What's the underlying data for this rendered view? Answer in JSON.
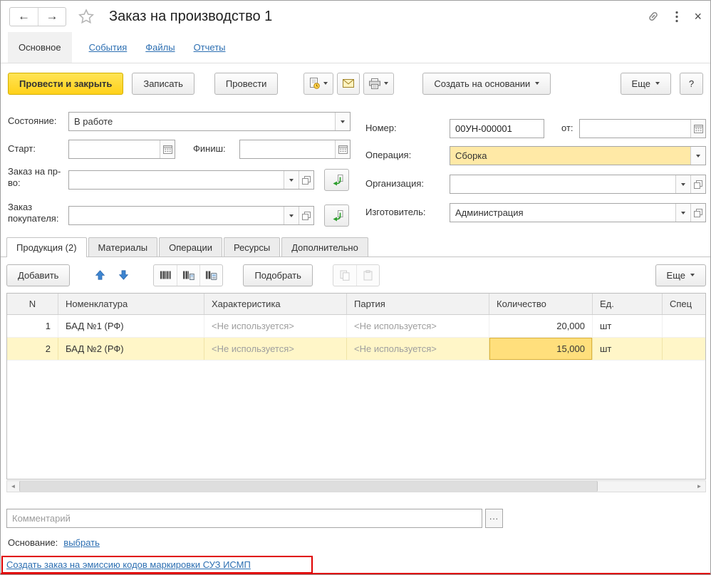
{
  "colors": {
    "primary_button": "#ffd11a",
    "selected_row": "#fff6c8",
    "selected_cell": "#ffdf7c",
    "operation_field_bg": "#ffe9a6",
    "link_blue": "#2d6fb2",
    "annotation_red": "#e00000"
  },
  "icons": {
    "back": "←",
    "forward": "→",
    "close": "×",
    "scroll_left": "◄",
    "scroll_right": "►"
  },
  "titlebar": {
    "title": "Заказ на производство 1"
  },
  "nav": {
    "items": [
      {
        "label": "Основное",
        "active": true
      },
      {
        "label": "События",
        "active": false
      },
      {
        "label": "Файлы",
        "active": false
      },
      {
        "label": "Отчеты",
        "active": false
      }
    ]
  },
  "toolbar": {
    "post_and_close": "Провести и закрыть",
    "write": "Записать",
    "post": "Провести",
    "create_based_on": "Создать на основании",
    "more": "Еще",
    "help": "?"
  },
  "form": {
    "state_label": "Состояние:",
    "state_value": "В работе",
    "start_label": "Старт:",
    "start_value": "",
    "finish_label": "Финиш:",
    "finish_value": "",
    "production_order_label": "Заказ на пр-во:",
    "production_order_value": "",
    "customer_order_label": "Заказ покупателя:",
    "customer_order_value": "",
    "number_label": "Номер:",
    "number_value": "00УН-000001",
    "from_label": "от:",
    "date_value": "",
    "operation_label": "Операция:",
    "operation_value": "Сборка",
    "organization_label": "Организация:",
    "organization_value": "",
    "manufacturer_label": "Изготовитель:",
    "manufacturer_value": "Администрация"
  },
  "tabs": [
    {
      "label": "Продукция (2)",
      "active": true
    },
    {
      "label": "Материалы",
      "active": false
    },
    {
      "label": "Операции",
      "active": false
    },
    {
      "label": "Ресурсы",
      "active": false
    },
    {
      "label": "Дополнительно",
      "active": false
    }
  ],
  "grid_toolbar": {
    "add": "Добавить",
    "pick": "Подобрать",
    "more": "Еще"
  },
  "grid": {
    "columns": [
      "N",
      "Номенклатура",
      "Характеристика",
      "Партия",
      "Количество",
      "Ед.",
      "Спец"
    ],
    "rows": [
      {
        "n": "1",
        "nomenclature": "БАД №1 (РФ)",
        "characteristic": "<Не используется>",
        "batch": "<Не используется>",
        "quantity": "20,000",
        "unit": "шт"
      },
      {
        "n": "2",
        "nomenclature": "БАД №2 (РФ)",
        "characteristic": "<Не используется>",
        "batch": "<Не используется>",
        "quantity": "15,000",
        "unit": "шт"
      }
    ]
  },
  "footer": {
    "comment_placeholder": "Комментарий",
    "comment_value": "",
    "ellipsis": "...",
    "basis_label": "Основание:",
    "basis_link": "выбрать",
    "emission_link": "Создать заказ на эмиссию кодов маркировки СУЗ ИСМП"
  }
}
